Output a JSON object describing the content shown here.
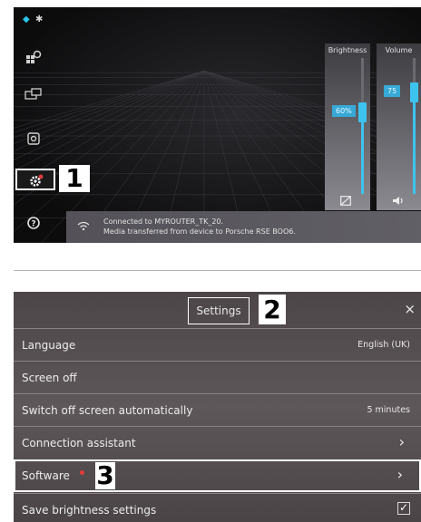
{
  "top": {
    "status_icons": [
      "wifi-icon",
      "bluetooth-icon"
    ],
    "sidebar_icons": [
      "apps-icon",
      "devices-icon",
      "media-icon",
      "settings-icon",
      "help-icon"
    ],
    "settings_badge_color": "#e23a3a",
    "brightness": {
      "title": "Brightness",
      "value_text": "60%",
      "level": 0.6,
      "icon": "screen-brightness-icon"
    },
    "volume": {
      "title": "Volume",
      "value_text": "75",
      "level": 0.75,
      "icon": "speaker-icon"
    },
    "notification": {
      "icon": "wifi-icon",
      "line1": "Connected to MYROUTER_TK_20.",
      "line2": "Media transferred from device to Porsche RSE BOO6."
    },
    "accent_color": "#3dc3ef"
  },
  "callouts": {
    "one": "1",
    "two": "2",
    "three": "3"
  },
  "settings": {
    "title": "Settings",
    "close_icon": "×",
    "rows": [
      {
        "label": "Language",
        "value": "English (UK)"
      },
      {
        "label": "Screen off"
      },
      {
        "label": "Switch off screen automatically",
        "value": "5 minutes"
      },
      {
        "label": "Connection assistant",
        "chevron": "›"
      },
      {
        "label": "Software",
        "chevron": "›",
        "has_update_badge": true
      },
      {
        "label": "Save brightness settings",
        "checked": true
      }
    ]
  }
}
